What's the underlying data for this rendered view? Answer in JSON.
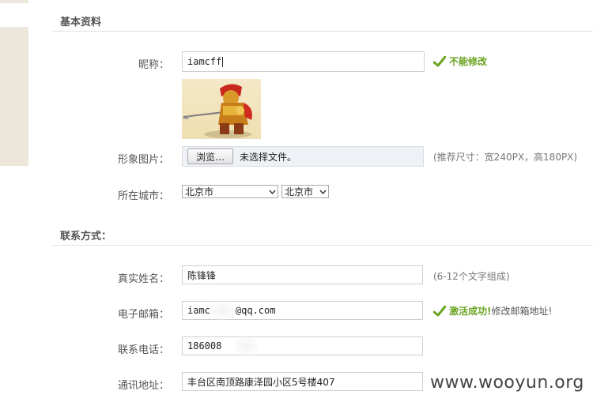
{
  "sections": {
    "basic_title": "基本资料",
    "contact_title": "联系方式："
  },
  "fields": {
    "nickname": {
      "label": "昵称：",
      "value": "iamcff",
      "status": "不能修改"
    },
    "avatar": {
      "label": "形象图片：",
      "browse_label": "浏览…",
      "file_status": "未选择文件。",
      "hint": "(推荐尺寸：宽240PX，高180PX)"
    },
    "city": {
      "label": "所在城市：",
      "province": "北京市",
      "city": "北京市"
    },
    "real_name": {
      "label": "真实姓名：",
      "value": "陈锋锋",
      "hint": "(6-12个文字组成)"
    },
    "email": {
      "label": "电子邮箱：",
      "value_prefix": "iamc",
      "value_suffix": "@qq.com",
      "status_ok": "激活成功!",
      "status_link": "修改邮箱地址!"
    },
    "phone": {
      "label": "联系电话：",
      "value": "186008"
    },
    "address": {
      "label": "通讯地址：",
      "value": "丰台区南顶路康泽园小区5号楼407"
    }
  },
  "watermark": "www.wooyun.org",
  "colors": {
    "success": "#6aa31f",
    "sidebar": "#ede6da"
  }
}
